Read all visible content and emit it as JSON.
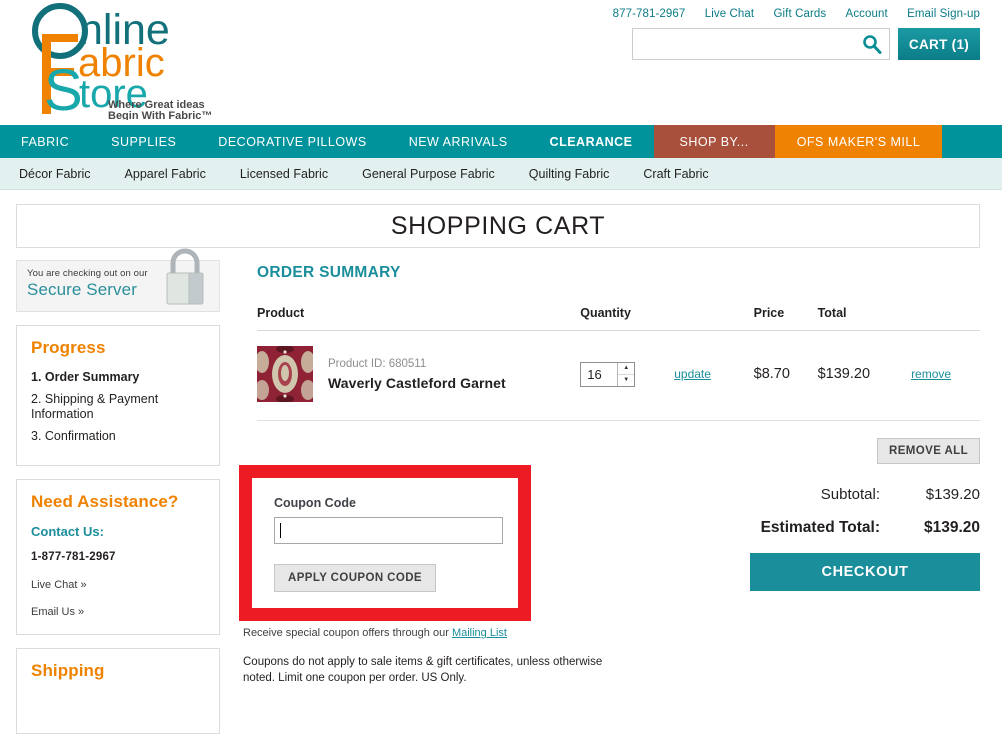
{
  "header": {
    "logo": {
      "word1": "Online",
      "word2": "Fabric",
      "word3": "Store",
      "tagline1": "Where Great ideas",
      "tagline2": "Begin With Fabric™"
    },
    "util_links": [
      {
        "label": "877-781-2967"
      },
      {
        "label": "Live Chat"
      },
      {
        "label": "Gift Cards"
      },
      {
        "label": "Account"
      },
      {
        "label": "Email Sign-up"
      }
    ],
    "search": {
      "value": "",
      "placeholder": "",
      "icon": "search-icon"
    },
    "cart": {
      "label": "CART (1)",
      "count": 1
    }
  },
  "nav": {
    "main": [
      {
        "label": "FABRIC",
        "style": "plain"
      },
      {
        "label": "SUPPLIES",
        "style": "plain"
      },
      {
        "label": "DECORATIVE PILLOWS",
        "style": "plain"
      },
      {
        "label": "NEW ARRIVALS",
        "style": "plain"
      },
      {
        "label": "CLEARANCE",
        "style": "bold"
      },
      {
        "label": "SHOP BY...",
        "style": "shopby"
      },
      {
        "label": "OFS MAKER'S MILL",
        "style": "mill"
      }
    ],
    "sub": [
      {
        "label": "Décor Fabric"
      },
      {
        "label": "Apparel Fabric"
      },
      {
        "label": "Licensed Fabric"
      },
      {
        "label": "General Purpose Fabric"
      },
      {
        "label": "Quilting Fabric"
      },
      {
        "label": "Craft Fabric"
      }
    ]
  },
  "page": {
    "title": "SHOPPING CART"
  },
  "sidebar": {
    "secure": {
      "line1": "You are checking out on our",
      "line2": "Secure Server",
      "icon": "padlock-icon"
    },
    "progress": {
      "title": "Progress",
      "steps": [
        {
          "label": "1. Order Summary",
          "current": true
        },
        {
          "label": "2. Shipping & Payment Information",
          "current": false
        },
        {
          "label": "3. Confirmation",
          "current": false
        }
      ]
    },
    "assistance": {
      "title": "Need Assistance?",
      "contact_label": "Contact Us:",
      "phone": "1-877-781-2967",
      "live_chat": "Live Chat »",
      "email_us": "Email Us »"
    },
    "shipping": {
      "title": "Shipping"
    }
  },
  "order_summary": {
    "title": "ORDER SUMMARY",
    "columns": {
      "product": "Product",
      "quantity": "Quantity",
      "price": "Price",
      "total": "Total",
      "remove": ""
    },
    "items": [
      {
        "product_id": "Product ID: 680511",
        "name": "Waverly Castleford Garnet",
        "quantity": "16",
        "update_label": "update",
        "price": "$8.70",
        "total": "$139.20",
        "remove_label": "remove",
        "swatch_colors": {
          "base": "#8f2234",
          "motif": "#cfc6ad",
          "dark": "#5e1622"
        }
      }
    ],
    "remove_all_label": "REMOVE ALL",
    "subtotal_label": "Subtotal:",
    "subtotal_value": "$139.20",
    "estimated_total_label": "Estimated Total:",
    "estimated_total_value": "$139.20",
    "checkout_label": "CHECKOUT"
  },
  "coupon": {
    "label": "Coupon Code",
    "value": "",
    "placeholder": "",
    "apply_label": "APPLY COUPON CODE",
    "note_prefix": "Receive special coupon offers through our ",
    "note_link": "Mailing List",
    "fine_print": "Coupons do not apply to sale items & gift certificates, unless otherwise noted. Limit one coupon per order. US Only.",
    "highlight_color": "#ed1c24"
  },
  "colors": {
    "teal": "#00939b",
    "teal_dark": "#1b8e9b",
    "orange": "#ef8200",
    "brick": "#a9503c",
    "subnav_bg": "#e2f1f0",
    "highlight_red": "#ed1c24"
  }
}
